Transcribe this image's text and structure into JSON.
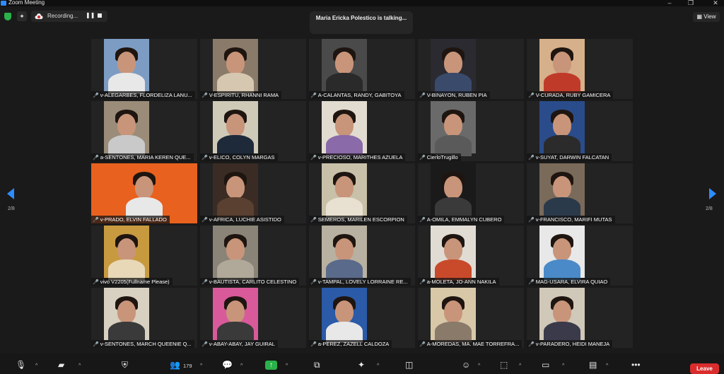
{
  "window": {
    "title": "Zoom Meeting"
  },
  "topbar": {
    "recording_label": "Recording...",
    "pause_glyph": "❚❚",
    "talking": "Maria Ericka Polestico is talking...",
    "view_label": "View"
  },
  "gallery": {
    "page_left": "2/8",
    "page_right": "2/8",
    "tiles": [
      {
        "name": "v-ALEGARBES, FLORDELIZA LANU...",
        "bg": "#7d9cc4",
        "shirt": "#e8e8e8"
      },
      {
        "name": "V-ESPIRITU, RHANNI RAMA",
        "bg": "#8a7a6a",
        "shirt": "#d6c7b0"
      },
      {
        "name": "A-CALANTAS, RANDY, GABITOYA",
        "bg": "#4a4a4a",
        "shirt": "#2a2a2a"
      },
      {
        "name": "V-BINAYON, RUBEN PIA",
        "bg": "#2a2a30",
        "shirt": "#3a4a6a"
      },
      {
        "name": "V-CURADA, RUBY GAMICERA",
        "bg": "#d6b08a",
        "shirt": "#c03a2a"
      },
      {
        "name": "a-SENTONES, MARIA KEREN QUE...",
        "bg": "#9a8c78",
        "shirt": "#c9c9c9"
      },
      {
        "name": "v-ELICO, COLYN MARGAS",
        "bg": "#cfc9b8",
        "shirt": "#1e2a3a"
      },
      {
        "name": "v-PRECIOSO, MARITHES AZUELA",
        "bg": "#e2dcd0",
        "shirt": "#8a6aa8"
      },
      {
        "name": "CierloTrugillo",
        "bg": "#6a6a6a",
        "shirt": "#5a5a5a"
      },
      {
        "name": "v-SUYAT, DARWIN FALCATAN",
        "bg": "#2a4c8a",
        "shirt": "#2b2b2b"
      },
      {
        "name": "v-PRADO, ELVIN FALLADO",
        "bg": "#e8611e",
        "shirt": "#e8e8e8"
      },
      {
        "name": "v-AFRICA, LUCHIE ASISTIDO",
        "bg": "#3a2c24",
        "shirt": "#5a4030"
      },
      {
        "name": "SEMEROS, MARILEN ESCORPION",
        "bg": "#c8c0a8",
        "shirt": "#e8e0d0"
      },
      {
        "name": "A-OMILA, EMMALYN CUBERO",
        "bg": "#1a1a1a",
        "shirt": "#3a3a3a"
      },
      {
        "name": "v-FRANCISCO, MARIFI MUTAS",
        "bg": "#7a6a5a",
        "shirt": "#2a3a4a"
      },
      {
        "name": "vivo V2205(Fullname Please)",
        "bg": "#c89a40",
        "shirt": "#e8d8b8"
      },
      {
        "name": "v-BAUTISTA, CARLITO CELESTINO",
        "bg": "#8a8478",
        "shirt": "#b0a898"
      },
      {
        "name": "v-TAMPAL, LOVELY LORRAINE RE...",
        "bg": "#b8b0a0",
        "shirt": "#5a6a8a"
      },
      {
        "name": "a-MOLETA, JO-ANN NAKILA",
        "bg": "#e0dcd4",
        "shirt": "#c84a2a"
      },
      {
        "name": "MAG-USARA, ELVIRA QUIAO",
        "bg": "#e8e8e8",
        "shirt": "#4a8ac8"
      },
      {
        "name": "v-SENTONES, MARCH QUEENIE Q...",
        "bg": "#d8d0c0",
        "shirt": "#3a3a3a"
      },
      {
        "name": "v-ABAY-ABAY, JAY  GUIRAL",
        "bg": "#d85a9a",
        "shirt": "#3a3a3a"
      },
      {
        "name": "a-PEREZ, ZAZELL CALDOZA",
        "bg": "#2a5aa8",
        "shirt": "#e8e8e8"
      },
      {
        "name": "A-MOREDAS, MA. MAE TORREFRA...",
        "bg": "#d8c8a8",
        "shirt": "#8a7a6a"
      },
      {
        "name": "v-PARADERO, HEIDI MANEJA",
        "bg": "#d0c8b8",
        "shirt": "#3a3a4a"
      }
    ]
  },
  "toolbar": {
    "participants_count": "179",
    "leave_label": "Leave"
  },
  "icons": {
    "mic": "mic-muted-icon",
    "video": "video-off-icon",
    "security": "shield-icon",
    "participants": "participants-icon",
    "chat": "chat-icon",
    "share": "share-screen-icon",
    "apps": "apps-icon",
    "ai": "ai-companion-icon",
    "record": "record-icon",
    "reactions": "reactions-icon",
    "more": "more-icon"
  },
  "colors": {
    "accent": "#2d8cff",
    "leave": "#d92d2d",
    "share": "#2ab24a",
    "muted": "#e02828"
  }
}
